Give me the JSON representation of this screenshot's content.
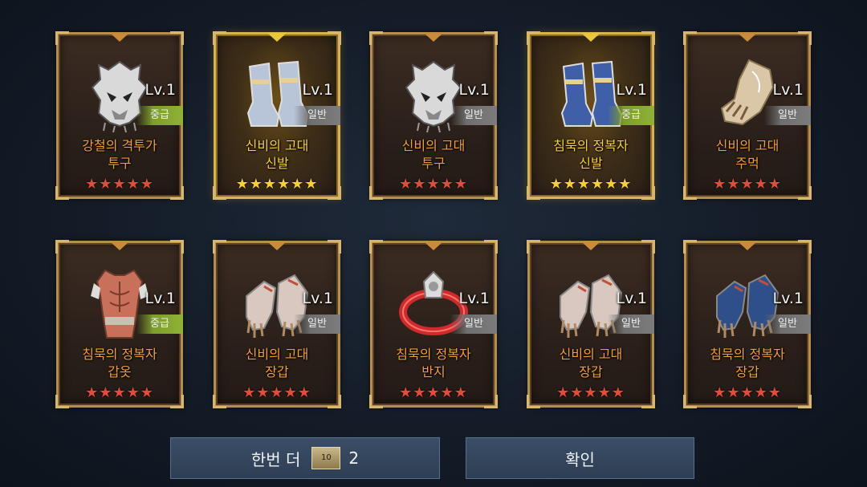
{
  "cards": [
    {
      "level": "Lv.1",
      "grade": "중급",
      "grade_type": "mid",
      "name1": "강철의 격투가",
      "name2": "투구",
      "stars": "★★★★★",
      "star_color": "red",
      "rarity": "normal",
      "icon": "helmet-icon",
      "color": "#d9d9d9"
    },
    {
      "level": "Lv.1",
      "grade": "일반",
      "grade_type": "normal",
      "name1": "신비의 고대",
      "name2": "신발",
      "stars": "★★★★★★",
      "star_color": "gold",
      "rarity": "legend",
      "icon": "boots-icon",
      "color": "#b8c4d8"
    },
    {
      "level": "Lv.1",
      "grade": "일반",
      "grade_type": "normal",
      "name1": "신비의 고대",
      "name2": "투구",
      "stars": "★★★★★",
      "star_color": "red",
      "rarity": "normal",
      "icon": "helmet-icon",
      "color": "#d9d9d9"
    },
    {
      "level": "Lv.1",
      "grade": "중급",
      "grade_type": "mid",
      "name1": "침묵의 정복자",
      "name2": "신발",
      "stars": "★★★★★★",
      "star_color": "gold",
      "rarity": "legend",
      "icon": "boots-icon",
      "color": "#3f5fa8"
    },
    {
      "level": "Lv.1",
      "grade": "일반",
      "grade_type": "normal",
      "name1": "신비의 고대",
      "name2": "주먹",
      "stars": "★★★★★",
      "star_color": "red",
      "rarity": "normal",
      "icon": "gauntlet-icon",
      "color": "#d9c7a8"
    },
    {
      "level": "Lv.1",
      "grade": "중급",
      "grade_type": "mid",
      "name1": "침묵의 정복자",
      "name2": "갑옷",
      "stars": "★★★★★",
      "star_color": "red",
      "rarity": "normal",
      "icon": "armor-icon",
      "color": "#c8705a"
    },
    {
      "level": "Lv.1",
      "grade": "일반",
      "grade_type": "normal",
      "name1": "신비의 고대",
      "name2": "장갑",
      "stars": "★★★★★",
      "star_color": "red",
      "rarity": "normal",
      "icon": "gloves-icon",
      "color": "#d8c8c0"
    },
    {
      "level": "Lv.1",
      "grade": "일반",
      "grade_type": "normal",
      "name1": "침묵의 정복자",
      "name2": "반지",
      "stars": "★★★★★",
      "star_color": "red",
      "rarity": "normal",
      "icon": "ring-icon",
      "color": "#d02a2a"
    },
    {
      "level": "Lv.1",
      "grade": "일반",
      "grade_type": "normal",
      "name1": "신비의 고대",
      "name2": "장갑",
      "stars": "★★★★★",
      "star_color": "red",
      "rarity": "normal",
      "icon": "gloves-icon",
      "color": "#d8c8c0"
    },
    {
      "level": "Lv.1",
      "grade": "일반",
      "grade_type": "normal",
      "name1": "침묵의 정복자",
      "name2": "장갑",
      "stars": "★★★★★",
      "star_color": "red",
      "rarity": "normal",
      "icon": "gloves-icon",
      "color": "#2f4f8a"
    }
  ],
  "buttons": {
    "again_label": "한번 더",
    "ticket_label": "10",
    "ticket_count": "2",
    "confirm_label": "확인"
  }
}
